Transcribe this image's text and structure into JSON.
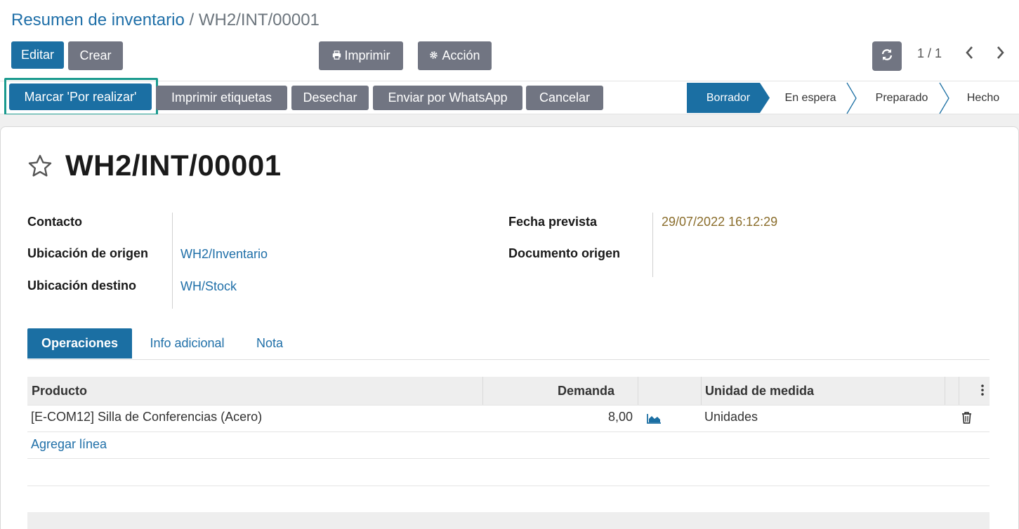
{
  "breadcrumb": {
    "parent": "Resumen de inventario",
    "separator": "/",
    "current": "WH2/INT/00001"
  },
  "control_panel": {
    "edit_label": "Editar",
    "create_label": "Crear",
    "print_label": "Imprimir",
    "action_label": "Acción",
    "pager_text": "1 / 1"
  },
  "status_actions": {
    "mark_todo": "Marcar 'Por realizar'",
    "print_labels": "Imprimir etiquetas",
    "scrap": "Desechar",
    "send_whatsapp": "Enviar por WhatsApp",
    "cancel": "Cancelar"
  },
  "stages": [
    {
      "label": "Borrador",
      "active": true
    },
    {
      "label": "En espera",
      "active": false
    },
    {
      "label": "Preparado",
      "active": false
    },
    {
      "label": "Hecho",
      "active": false
    }
  ],
  "record": {
    "title": "WH2/INT/00001",
    "fields_left": [
      {
        "label": "Contacto",
        "value": ""
      },
      {
        "label": "Ubicación de origen",
        "value": "WH2/Inventario"
      },
      {
        "label": "Ubicación destino",
        "value": "WH/Stock"
      }
    ],
    "fields_right": [
      {
        "label": "Fecha prevista",
        "value": "29/07/2022 16:12:29"
      },
      {
        "label": "Documento origen",
        "value": ""
      }
    ]
  },
  "tabs": [
    {
      "label": "Operaciones",
      "active": true
    },
    {
      "label": "Info adicional",
      "active": false
    },
    {
      "label": "Nota",
      "active": false
    }
  ],
  "table": {
    "columns": [
      "Producto",
      "Demanda",
      "Unidad de medida"
    ],
    "rows": [
      {
        "product": "[E-COM12] Silla de Conferencias (Acero)",
        "demand": "8,00",
        "uom": "Unidades"
      }
    ],
    "add_line": "Agregar línea"
  },
  "icons": {
    "print": "printer-icon",
    "action": "gear-icon",
    "refresh": "refresh-icon",
    "favorite": "star-icon",
    "forecast": "area-chart-icon",
    "delete": "trash-icon",
    "optional_columns": "vertical-dots-icon"
  },
  "colors": {
    "primary": "#1b6fa3",
    "secondary": "#717582",
    "link": "#1f6fa8",
    "highlight": "#1a9a8e",
    "date": "#8a6d2b"
  }
}
